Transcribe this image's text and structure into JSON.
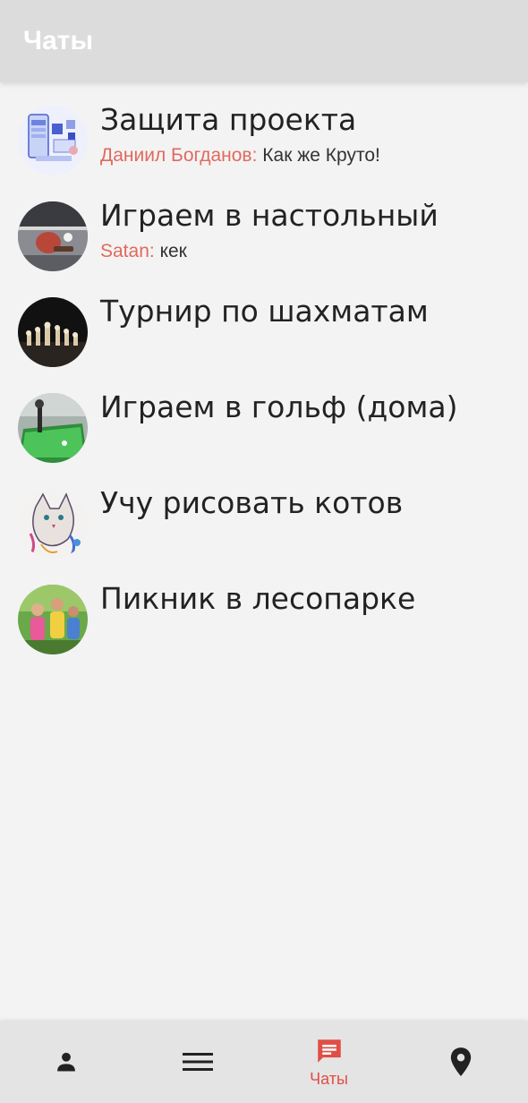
{
  "header": {
    "title": "Чаты"
  },
  "chats": [
    {
      "title": "Защита проекта",
      "last_sender": "Даниил Богданов:",
      "last_message": "Как же Круто!",
      "avatar": "project-illustration"
    },
    {
      "title": "Играем в настольный",
      "last_sender": "Satan:",
      "last_message": "кек",
      "avatar": "table-tennis-photo"
    },
    {
      "title": "Турнир по шахматам",
      "last_sender": "",
      "last_message": "",
      "avatar": "chess-photo"
    },
    {
      "title": "Играем в гольф (дома)",
      "last_sender": "",
      "last_message": "",
      "avatar": "golf-photo"
    },
    {
      "title": "Учу рисовать котов",
      "last_sender": "",
      "last_message": "",
      "avatar": "cat-drawing"
    },
    {
      "title": "Пикник в лесопарке",
      "last_sender": "",
      "last_message": "",
      "avatar": "picnic-photo"
    }
  ],
  "bottom_nav": {
    "items": [
      {
        "icon": "person-icon",
        "label": ""
      },
      {
        "icon": "menu-icon",
        "label": ""
      },
      {
        "icon": "chat-icon",
        "label": "Чаты"
      },
      {
        "icon": "location-pin-icon",
        "label": ""
      }
    ],
    "active_index": 2
  },
  "colors": {
    "accent": "#e04e46",
    "sender": "#e06a5e",
    "header_bg": "#dcdcdc",
    "nav_bg": "#e4e4e4"
  }
}
